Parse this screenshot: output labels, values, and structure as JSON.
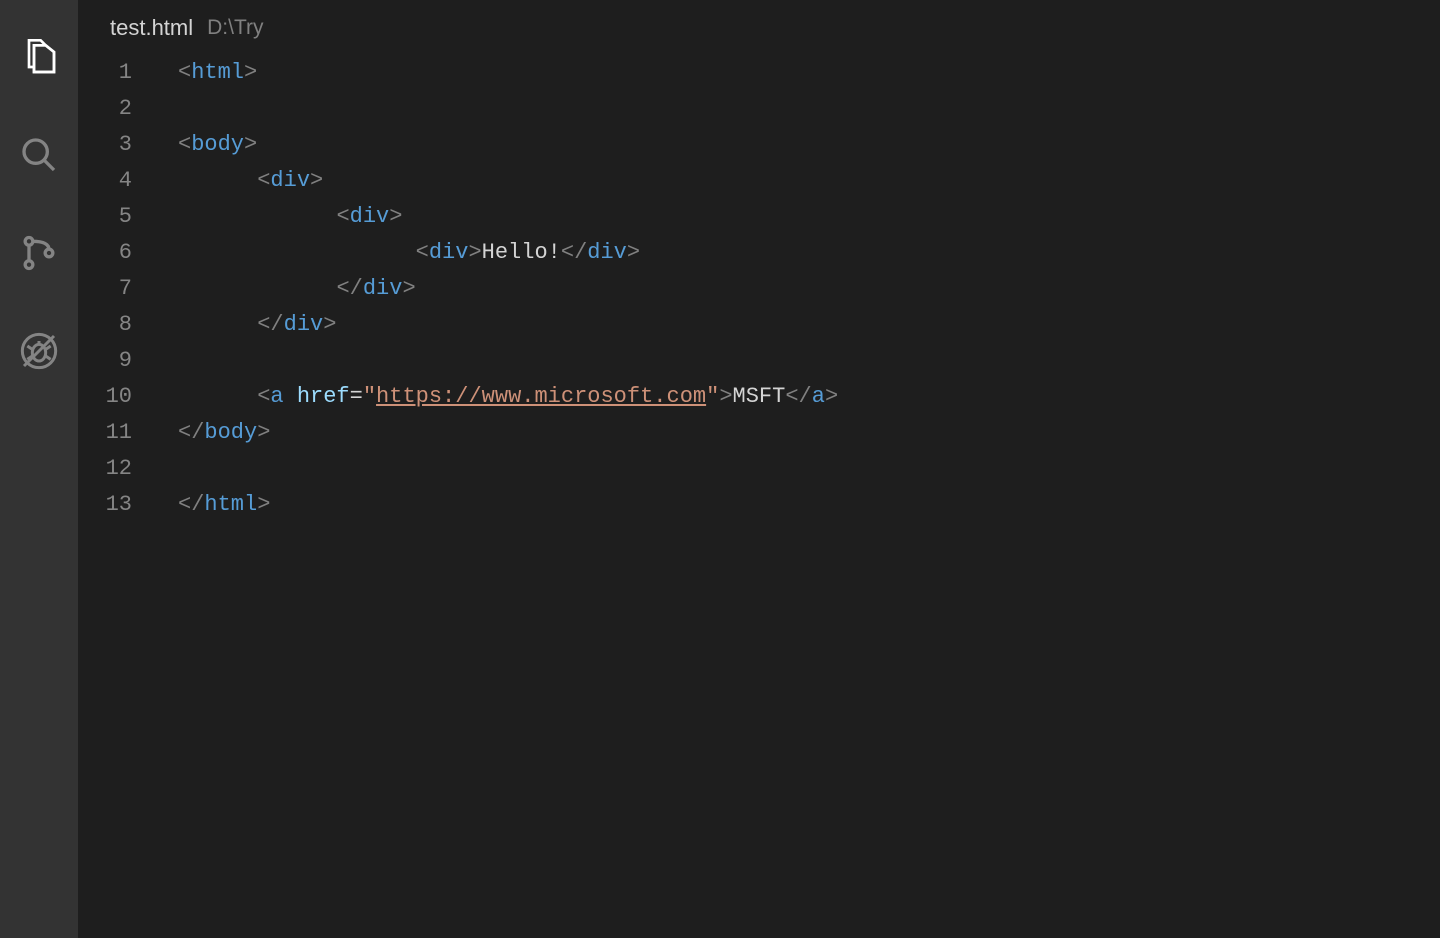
{
  "activity": {
    "items": [
      {
        "name": "explorer-icon",
        "active": true
      },
      {
        "name": "search-icon",
        "active": false
      },
      {
        "name": "source-control-icon",
        "active": false
      },
      {
        "name": "debug-icon",
        "active": false
      }
    ]
  },
  "tab": {
    "filename": "test.html",
    "path": "D:\\Try"
  },
  "code": {
    "indentUnit": "      ",
    "lines": [
      {
        "n": "1",
        "indent": 0,
        "tokens": [
          [
            "br",
            "<"
          ],
          [
            "tag",
            "html"
          ],
          [
            "br",
            ">"
          ]
        ]
      },
      {
        "n": "2",
        "indent": 0,
        "tokens": []
      },
      {
        "n": "3",
        "indent": 0,
        "tokens": [
          [
            "br",
            "<"
          ],
          [
            "tag",
            "body"
          ],
          [
            "br",
            ">"
          ]
        ]
      },
      {
        "n": "4",
        "indent": 1,
        "tokens": [
          [
            "br",
            "<"
          ],
          [
            "tag",
            "div"
          ],
          [
            "br",
            ">"
          ]
        ]
      },
      {
        "n": "5",
        "indent": 2,
        "tokens": [
          [
            "br",
            "<"
          ],
          [
            "tag",
            "div"
          ],
          [
            "br",
            ">"
          ]
        ]
      },
      {
        "n": "6",
        "indent": 3,
        "tokens": [
          [
            "br",
            "<"
          ],
          [
            "tag",
            "div"
          ],
          [
            "br",
            ">"
          ],
          [
            "txt",
            "Hello!"
          ],
          [
            "br",
            "</"
          ],
          [
            "tag",
            "div"
          ],
          [
            "br",
            ">"
          ]
        ]
      },
      {
        "n": "7",
        "indent": 2,
        "tokens": [
          [
            "br",
            "</"
          ],
          [
            "tag",
            "div"
          ],
          [
            "br",
            ">"
          ]
        ]
      },
      {
        "n": "8",
        "indent": 1,
        "tokens": [
          [
            "br",
            "</"
          ],
          [
            "tag",
            "div"
          ],
          [
            "br",
            ">"
          ]
        ]
      },
      {
        "n": "9",
        "indent": 0,
        "tokens": []
      },
      {
        "n": "10",
        "indent": 1,
        "tokens": [
          [
            "br",
            "<"
          ],
          [
            "tag",
            "a"
          ],
          [
            "txt",
            " "
          ],
          [
            "attr",
            "href"
          ],
          [
            "op",
            "="
          ],
          [
            "str",
            "\""
          ],
          [
            "url",
            "https://www.microsoft.com"
          ],
          [
            "str",
            "\""
          ],
          [
            "br",
            ">"
          ],
          [
            "txt",
            "MSFT"
          ],
          [
            "br",
            "</"
          ],
          [
            "tag",
            "a"
          ],
          [
            "br",
            ">"
          ]
        ]
      },
      {
        "n": "11",
        "indent": 0,
        "tokens": [
          [
            "br",
            "</"
          ],
          [
            "tag",
            "body"
          ],
          [
            "br",
            ">"
          ]
        ]
      },
      {
        "n": "12",
        "indent": 0,
        "tokens": []
      },
      {
        "n": "13",
        "indent": 0,
        "tokens": [
          [
            "br",
            "</"
          ],
          [
            "tag",
            "html"
          ],
          [
            "br",
            ">"
          ]
        ]
      }
    ]
  }
}
